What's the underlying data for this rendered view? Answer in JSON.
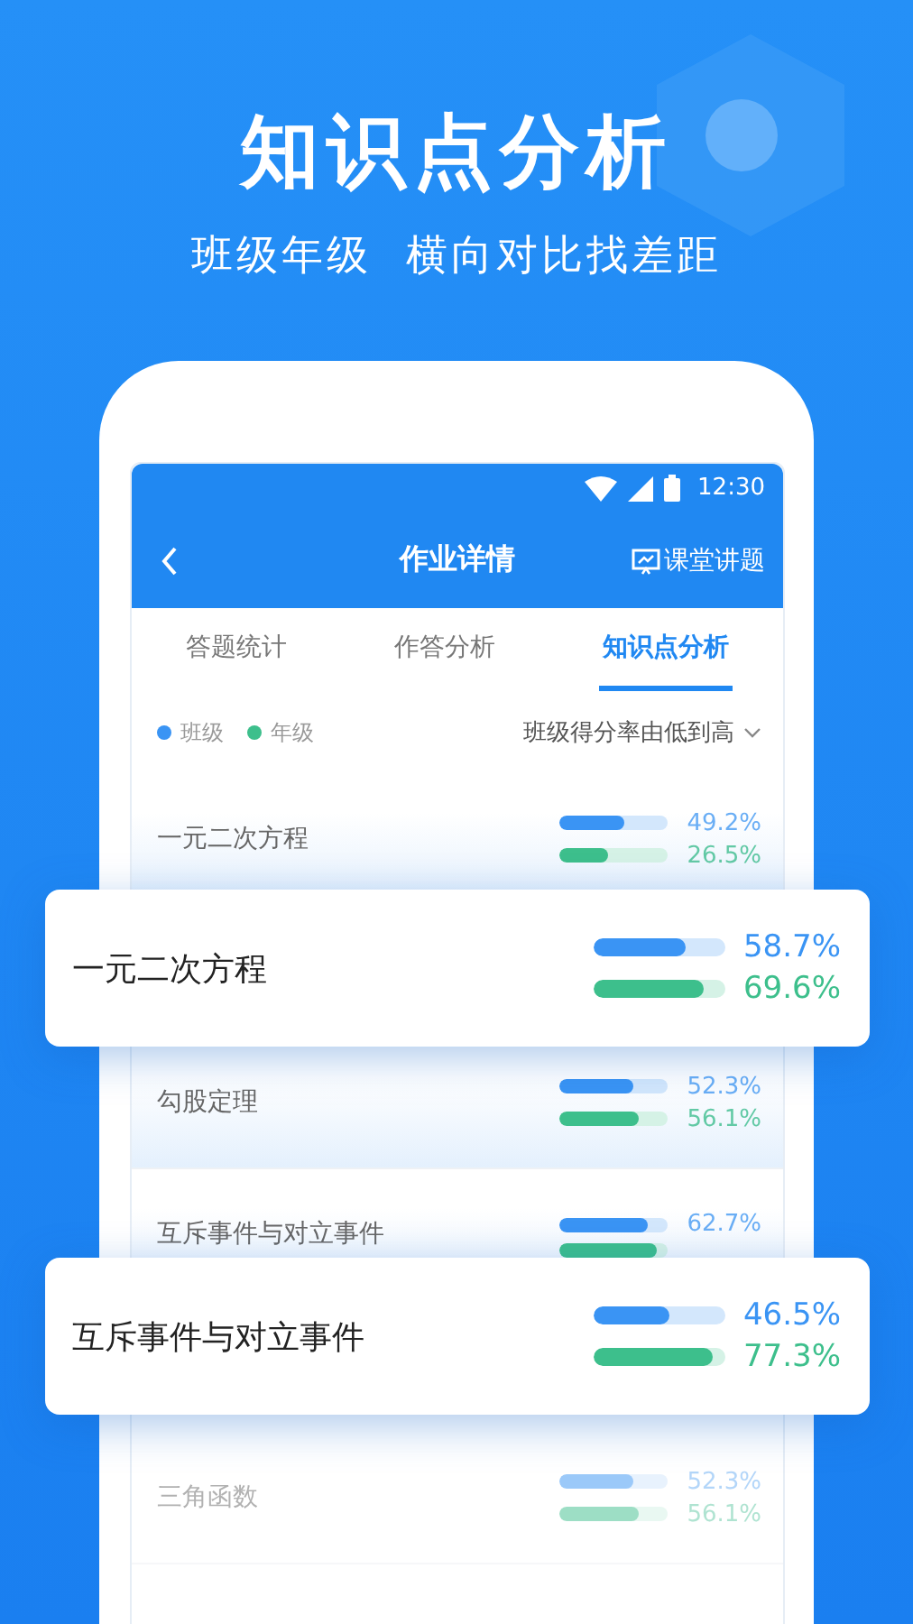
{
  "headline": "知识点分析",
  "subheadline": "班级年级  横向对比找差距",
  "status_bar": {
    "time": "12:30"
  },
  "header": {
    "title": "作业详情",
    "action": "课堂讲题"
  },
  "tabs": [
    {
      "label": "答题统计",
      "selected": false
    },
    {
      "label": "作答分析",
      "selected": false
    },
    {
      "label": "知识点分析",
      "selected": true
    }
  ],
  "legend": [
    {
      "label": "班级",
      "color": "#3a94f4"
    },
    {
      "label": "年级",
      "color": "#3dbf8c"
    }
  ],
  "sort": {
    "label": "班级得分率由低到高"
  },
  "items": [
    {
      "kind": "row",
      "name": "一元二次方程",
      "faded": false,
      "class": {
        "level": 0.6,
        "value": "49.2%"
      },
      "grade": {
        "level": 0.45,
        "value": "26.5%"
      }
    },
    {
      "kind": "card",
      "name": "一元二次方程",
      "class": {
        "level": 0.7,
        "value": "58.7%"
      },
      "grade": {
        "level": 0.84,
        "value": "69.6%"
      }
    },
    {
      "kind": "row",
      "name": "勾股定理",
      "faded": false,
      "class": {
        "level": 0.68,
        "value": "52.3%"
      },
      "grade": {
        "level": 0.74,
        "value": "56.1%"
      }
    },
    {
      "kind": "row",
      "name": "互斥事件与对立事件",
      "faded": false,
      "class": {
        "level": 0.82,
        "value": "62.7%"
      },
      "grade": {
        "level": 0.9
      }
    },
    {
      "kind": "card",
      "name": "互斥事件与对立事件",
      "class": {
        "level": 0.58,
        "value": "46.5%"
      },
      "grade": {
        "level": 0.9,
        "value": "77.3%"
      }
    },
    {
      "kind": "row",
      "name": "三角函数",
      "faded": true,
      "class": {
        "level": 0.68,
        "value": "52.3%"
      },
      "grade": {
        "level": 0.74,
        "value": "56.1%"
      }
    }
  ]
}
